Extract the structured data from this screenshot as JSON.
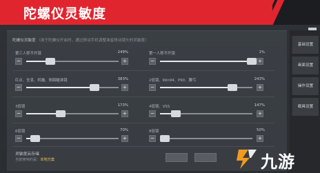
{
  "header": {
    "title": "陀螺仪灵敏度"
  },
  "description": {
    "label": "陀螺仪灵敏度",
    "hint": "（用于陀螺仪开启时，通过移动手机调整准星移动镜头的灵敏度）"
  },
  "sliders": [
    {
      "label": "第三人称不开镜",
      "value_text": "249%",
      "fraction": 0.26
    },
    {
      "label": "第一人称不开镜",
      "value_text": "1%",
      "fraction": 0.99
    },
    {
      "label": "红点、全息、机瞄、侧面瞄准镜",
      "value_text": "383%",
      "fraction": 0.74
    },
    {
      "label": "2倍镜、Win94、P90、腰弓",
      "value_text": "243%",
      "fraction": 0.78
    },
    {
      "label": "3倍镜",
      "value_text": "173%",
      "fraction": 0.37
    },
    {
      "label": "4倍镜、VSS",
      "value_text": "147%",
      "fraction": 0.17
    },
    {
      "label": "6倍镜",
      "value_text": "70%",
      "fraction": 0.1
    },
    {
      "label": "8倍镜",
      "value_text": "50%",
      "fraction": 0.05
    }
  ],
  "buttons": {
    "minus": "−",
    "plus": "+"
  },
  "cloud": {
    "title": "灵敏度云存储",
    "sub_prefix": "当前使用的是：",
    "sub_value": "本地方案"
  },
  "tabs": [
    "基础设置",
    "画面设置",
    "操作设置",
    "载具设置"
  ],
  "watermark": {
    "text": "九游"
  },
  "colors": {
    "banner": "#e1252f",
    "watermark_accent": "#f29a1f"
  }
}
